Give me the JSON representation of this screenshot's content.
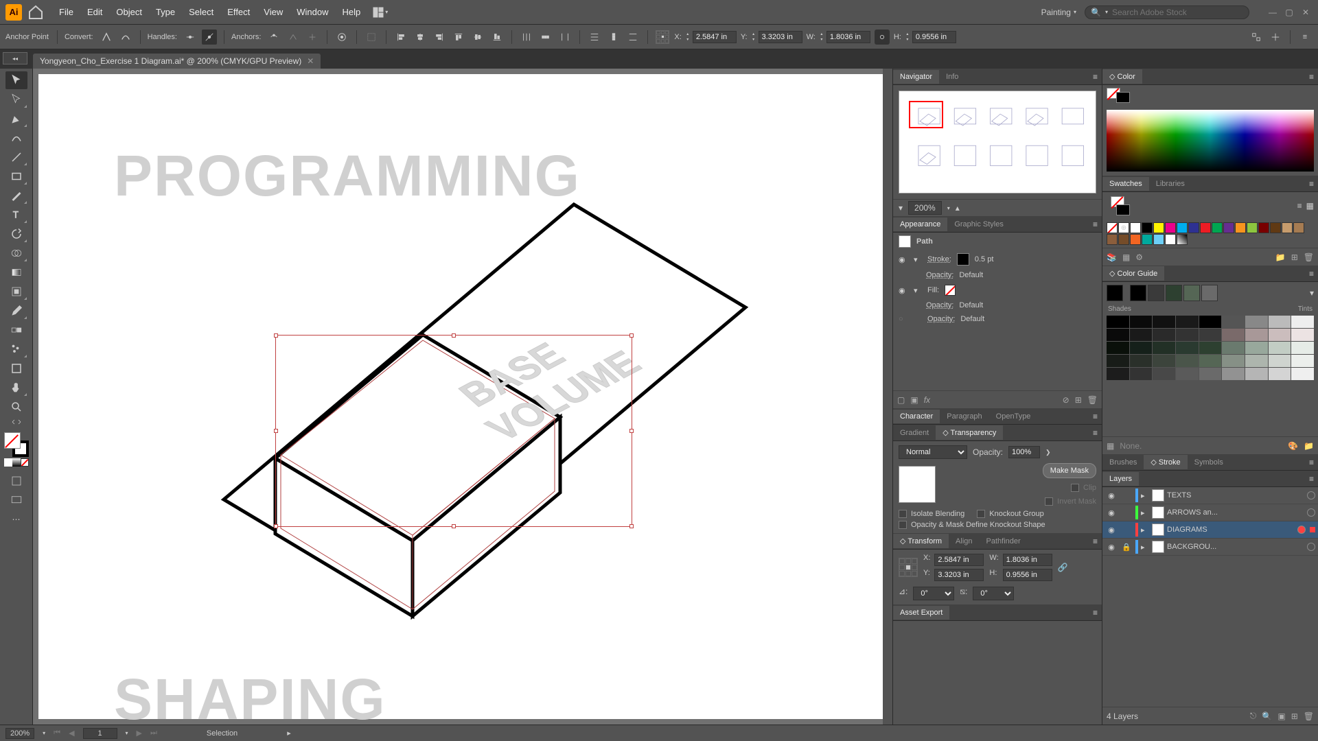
{
  "menus": [
    "File",
    "Edit",
    "Object",
    "Type",
    "Select",
    "Effect",
    "View",
    "Window",
    "Help"
  ],
  "workspace": "Painting",
  "search_placeholder": "Search Adobe Stock",
  "controlbar": {
    "anchor_label": "Anchor Point",
    "convert_label": "Convert:",
    "handles_label": "Handles:",
    "anchors_label": "Anchors:",
    "x_label": "X:",
    "x_val": "2.5847 in",
    "y_label": "Y:",
    "y_val": "3.3203 in",
    "w_label": "W:",
    "w_val": "1.8036 in",
    "h_label": "H:",
    "h_val": "0.9556 in"
  },
  "doc_tab": "Yongyeon_Cho_Exercise 1 Diagram.ai* @ 200% (CMYK/GPU Preview)",
  "canvas": {
    "heading1": "PROGRAMMING",
    "heading2": "SHAPING",
    "iso_text1": "BASE",
    "iso_text2": "VOLUME"
  },
  "navigator": {
    "tab1": "Navigator",
    "tab2": "Info",
    "zoom": "200%"
  },
  "appearance": {
    "tab1": "Appearance",
    "tab2": "Graphic Styles",
    "path": "Path",
    "stroke_label": "Stroke:",
    "stroke_val": "0.5 pt",
    "opacity_label": "Opacity:",
    "opacity_val": "Default",
    "fill_label": "Fill:"
  },
  "character": {
    "tabs": [
      "Character",
      "Paragraph",
      "OpenType"
    ]
  },
  "transparency": {
    "tabs": [
      "Gradient",
      "Transparency"
    ],
    "blend": "Normal",
    "opacity_label": "Opacity:",
    "opacity_val": "100%",
    "make_mask": "Make Mask",
    "clip": "Clip",
    "invert": "Invert Mask",
    "isolate": "Isolate Blending",
    "knockout": "Knockout Group",
    "mask_define": "Opacity & Mask Define Knockout Shape"
  },
  "transform": {
    "tabs": [
      "Transform",
      "Align",
      "Pathfinder"
    ],
    "x_label": "X:",
    "x_val": "2.5847 in",
    "y_label": "Y:",
    "y_val": "3.3203 in",
    "w_label": "W:",
    "w_val": "1.8036 in",
    "h_label": "H:",
    "h_val": "0.9556 in",
    "angle_label": "⊿:",
    "angle_val": "0°",
    "shear_label": "⧅:",
    "shear_val": "0°"
  },
  "asset_export": "Asset Export",
  "color": {
    "tab": "Color"
  },
  "swatches": {
    "tabs": [
      "Swatches",
      "Libraries"
    ]
  },
  "color_guide": {
    "tab": "Color Guide",
    "shades": "Shades",
    "tints": "Tints",
    "none": "None."
  },
  "brushes": {
    "tabs": [
      "Brushes",
      "Stroke",
      "Symbols"
    ]
  },
  "layers": {
    "tab": "Layers",
    "items": [
      {
        "name": "TEXTS",
        "color": "#4aa8ff"
      },
      {
        "name": "ARROWS an...",
        "color": "#3cff3c"
      },
      {
        "name": "DIAGRAMS",
        "color": "#ff4040",
        "selected": true
      },
      {
        "name": "BACKGROU...",
        "color": "#4aa8ff",
        "locked": true
      }
    ],
    "count": "4 Layers"
  },
  "status": {
    "zoom": "200%",
    "artboard": "1",
    "tool": "Selection"
  }
}
